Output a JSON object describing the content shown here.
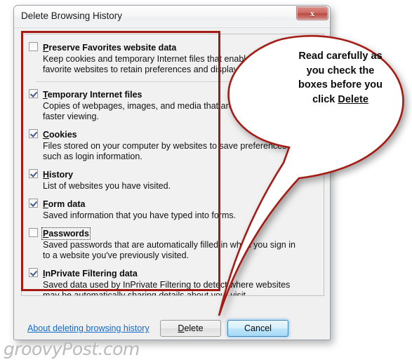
{
  "window": {
    "title": "Delete Browsing History",
    "close_button": "x",
    "close_icon": "close-icon"
  },
  "options": [
    {
      "id": "preserve-favorites",
      "checked": false,
      "focused": false,
      "accel": "P",
      "label_rest": "reserve Favorites website data",
      "desc": "Keep cookies and temporary Internet files that enable your favorite websites to retain preferences and display faster.",
      "separator_after": true
    },
    {
      "id": "temporary-internet-files",
      "checked": true,
      "focused": false,
      "accel": "T",
      "label_rest": "emporary Internet files",
      "desc": "Copies of webpages, images, and media that are saved for faster viewing.",
      "separator_after": false
    },
    {
      "id": "cookies",
      "checked": true,
      "focused": false,
      "accel": "C",
      "label_rest": "ookies",
      "desc": "Files stored on your computer by websites to save preferences such as login information.",
      "separator_after": false
    },
    {
      "id": "history",
      "checked": true,
      "focused": false,
      "accel": "H",
      "label_rest": "istory",
      "desc": "List of websites you have visited.",
      "separator_after": false
    },
    {
      "id": "form-data",
      "checked": true,
      "focused": false,
      "accel": "F",
      "label_rest": "orm data",
      "desc": "Saved information that you have typed into forms.",
      "separator_after": false
    },
    {
      "id": "passwords",
      "checked": false,
      "focused": true,
      "accel": "P",
      "label_rest": "asswords",
      "desc": "Saved passwords that are automatically filled in when you sign in to a website you've previously visited.",
      "separator_after": false
    },
    {
      "id": "inprivate-filtering-data",
      "checked": true,
      "focused": false,
      "accel": "I",
      "label_rest": "nPrivate Filtering data",
      "desc": "Saved data used by InPrivate Filtering to detect where websites may be automatically sharing details about your visit.",
      "separator_after": false
    }
  ],
  "footer": {
    "about_link": "About deleting browsing history",
    "delete_accel": "D",
    "delete_rest": "elete",
    "cancel_label": "Cancel"
  },
  "annotation": {
    "callout_line1": "Read carefully as",
    "callout_line2": "you check the",
    "callout_line3": "boxes before you",
    "callout_line4_prefix": "click ",
    "callout_line4_emphasis": "Delete",
    "red_color": "#a41b14"
  },
  "watermark": {
    "text": "groovyPost.com"
  }
}
